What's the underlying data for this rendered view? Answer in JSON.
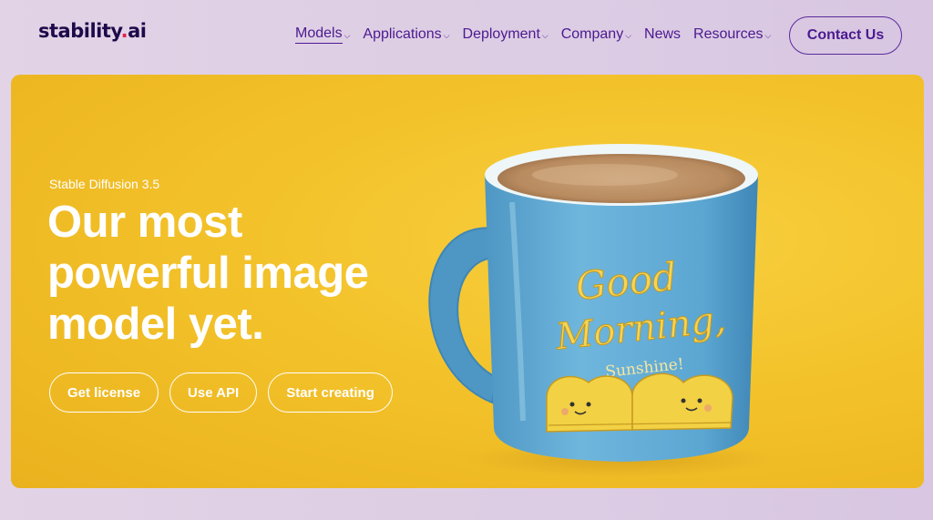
{
  "brand": {
    "name": "stability",
    "dot": ".",
    "suffix": "ai"
  },
  "nav": {
    "items": [
      {
        "label": "Models",
        "dropdown": true,
        "active": true
      },
      {
        "label": "Applications",
        "dropdown": true
      },
      {
        "label": "Deployment",
        "dropdown": true
      },
      {
        "label": "Company",
        "dropdown": true
      },
      {
        "label": "News",
        "dropdown": false
      },
      {
        "label": "Resources",
        "dropdown": true
      }
    ],
    "chevron": "⌵",
    "contact_label": "Contact Us"
  },
  "hero": {
    "eyebrow": "Stable Diffusion 3.5",
    "headline": [
      "Our most",
      "powerful image",
      "model yet."
    ],
    "buttons": [
      "Get license",
      "Use API",
      "Start creating"
    ],
    "image": {
      "subject": "coffee-mug",
      "mug_text": [
        "Good",
        "Morning,",
        "Sunshine!"
      ]
    }
  },
  "colors": {
    "accent": "#4b1a8f",
    "logo_dot": "#e8204a",
    "hero_bg": "#f3c22a",
    "mug": "#5fa9d3"
  }
}
